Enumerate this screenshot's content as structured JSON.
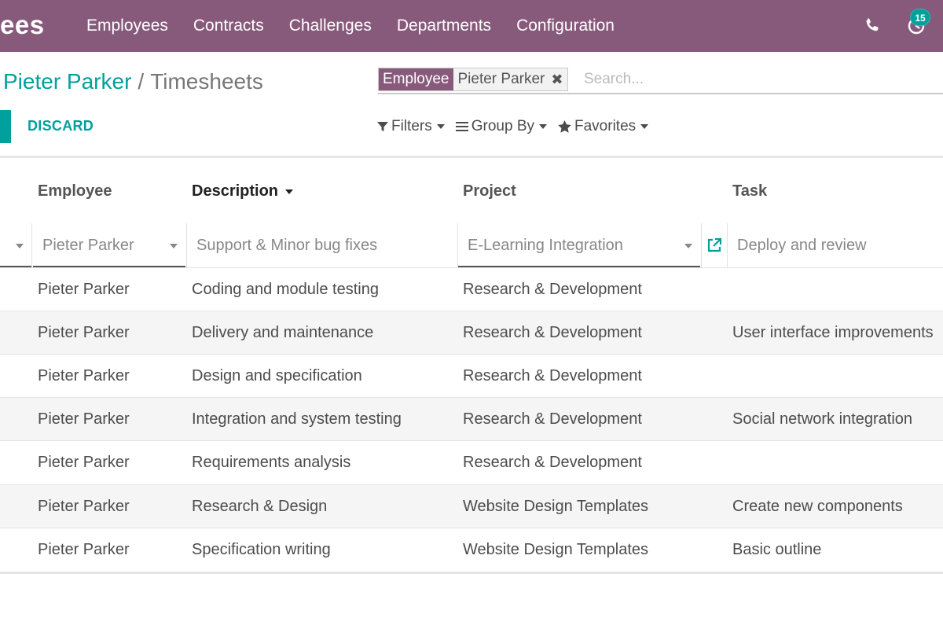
{
  "navbar": {
    "app_name": "ees",
    "menu": [
      "Employees",
      "Contracts",
      "Challenges",
      "Departments",
      "Configuration"
    ],
    "activity_count": "15",
    "color": "#875a7b"
  },
  "breadcrumb": {
    "parent": "Pieter Parker",
    "separator": "/",
    "current": "Timesheets"
  },
  "search": {
    "facet_label": "Employee",
    "facet_value": "Pieter Parker",
    "remove_icon": "✖",
    "placeholder": "Search..."
  },
  "buttons": {
    "discard": "DISCARD"
  },
  "filters": {
    "filters": "Filters",
    "group_by": "Group By",
    "favorites": "Favorites"
  },
  "table": {
    "headers": {
      "employee": "Employee",
      "description": "Description",
      "project": "Project",
      "task": "Task"
    },
    "editing": {
      "employee": "Pieter Parker",
      "description": "Support & Minor bug fixes",
      "project": "E-Learning Integration",
      "task": "Deploy and review"
    },
    "rows": [
      {
        "employee": "Pieter Parker",
        "description": "Coding and module testing",
        "project": "Research & Development",
        "task": ""
      },
      {
        "employee": "Pieter Parker",
        "description": "Delivery and maintenance",
        "project": "Research & Development",
        "task": "User interface improvements"
      },
      {
        "employee": "Pieter Parker",
        "description": "Design and specification",
        "project": "Research & Development",
        "task": ""
      },
      {
        "employee": "Pieter Parker",
        "description": "Integration and system testing",
        "project": "Research & Development",
        "task": "Social network integration"
      },
      {
        "employee": "Pieter Parker",
        "description": "Requirements analysis",
        "project": "Research & Development",
        "task": ""
      },
      {
        "employee": "Pieter Parker",
        "description": "Research & Design",
        "project": "Website Design Templates",
        "task": "Create new components"
      },
      {
        "employee": "Pieter Parker",
        "description": "Specification writing",
        "project": "Website Design Templates",
        "task": "Basic outline"
      }
    ]
  },
  "colors": {
    "primary": "#875a7b",
    "accent": "#00a09d"
  },
  "icons": [
    "phone-icon",
    "activity-icon",
    "filter-icon",
    "group-by-icon",
    "star-icon",
    "external-link-icon"
  ]
}
